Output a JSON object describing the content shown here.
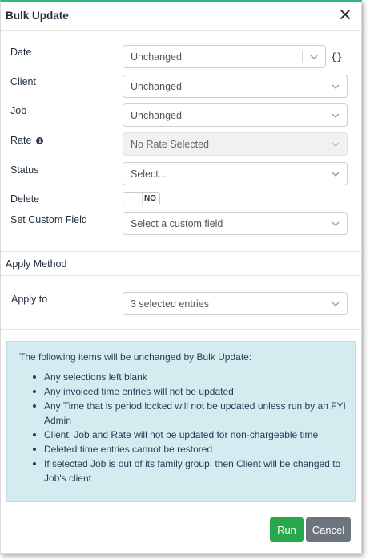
{
  "dialog": {
    "title": "Bulk Update"
  },
  "fields": {
    "date": {
      "label": "Date",
      "value": "Unchanged"
    },
    "client": {
      "label": "Client",
      "value": "Unchanged"
    },
    "job": {
      "label": "Job",
      "value": "Unchanged"
    },
    "rate": {
      "label": "Rate",
      "value": "No Rate Selected",
      "disabled": true
    },
    "status": {
      "label": "Status",
      "value": "Select..."
    },
    "delete": {
      "label": "Delete",
      "toggle_text": "NO"
    },
    "custom_field": {
      "label": "Set Custom Field",
      "value": "Select a custom field"
    }
  },
  "apply_method": {
    "section_title": "Apply Method",
    "apply_to_label": "Apply to",
    "apply_to_value": "3 selected entries"
  },
  "notice": {
    "intro": "The following items will be unchanged by Bulk Update:",
    "items": [
      "Any selections left blank",
      "Any invoiced time entries will not be updated",
      "Any Time that is period locked will not be updated unless run by an FYI Admin",
      "Client, Job and Rate will not be updated for non-chargeable time",
      "Deleted time entries cannot be restored",
      "If selected Job is out of its family group, then Client will be changed to Job's client"
    ]
  },
  "buttons": {
    "run": "Run",
    "cancel": "Cancel"
  },
  "colors": {
    "accent": "#2fb77e",
    "run": "#27a84a",
    "cancel": "#6c757d",
    "notice_bg": "#d4ecef"
  }
}
